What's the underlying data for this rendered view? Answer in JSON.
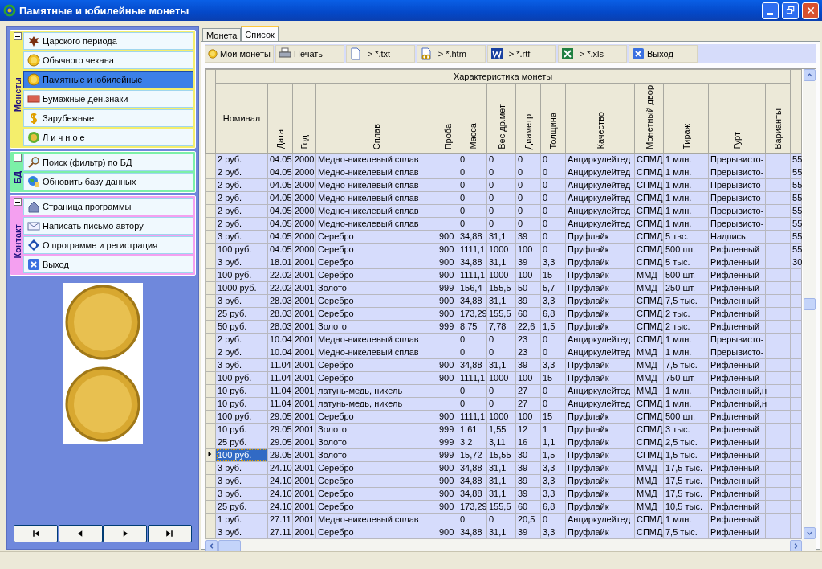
{
  "window": {
    "title": "Памятные и юбилейные монеты"
  },
  "sidebar": {
    "groups": [
      {
        "title": "Монеты",
        "color": "#f4ee6c",
        "expanded": true,
        "items": [
          {
            "label": "Царского периода",
            "selected": false
          },
          {
            "label": "Обычного чекана",
            "selected": false
          },
          {
            "label": "Памятные и юбилейные",
            "selected": true
          },
          {
            "label": "Бумажные ден.знаки",
            "selected": false
          },
          {
            "label": "Зарубежные",
            "selected": false
          },
          {
            "label": "Л и ч н о е",
            "selected": false
          }
        ]
      },
      {
        "title": "БД",
        "color": "#7cf0a8",
        "expanded": true,
        "items": [
          {
            "label": "Поиск (фильтр) по БД",
            "selected": false
          },
          {
            "label": "Обновить базу данных",
            "selected": false
          }
        ]
      },
      {
        "title": "Контакт",
        "color": "#f4a0f0",
        "expanded": true,
        "items": [
          {
            "label": "Страница программы",
            "selected": false
          },
          {
            "label": "Написать письмо автору",
            "selected": false
          },
          {
            "label": "О программе и регистрация",
            "selected": false
          },
          {
            "label": "Выход",
            "selected": false
          }
        ]
      }
    ]
  },
  "tabs": [
    {
      "label": "Монета",
      "selected": false
    },
    {
      "label": "Список",
      "selected": true
    }
  ],
  "toolbar": [
    "Мои монеты",
    "Печать",
    "-> *.txt",
    "-> *.htm",
    "-> *.rtf",
    "-> *.xls",
    "Выход"
  ],
  "table": {
    "group_header": "Характеристика монеты",
    "columns": [
      "Номинал",
      "Дата",
      "Год",
      "Сплав",
      "Проба",
      "Масса",
      "Вес др.мет.",
      "Диаметр",
      "Толщина",
      "Качество",
      "Монетный двор",
      "Тираж",
      "Гурт",
      "Варианты"
    ],
    "rows": [
      {
        "selected": false,
        "cells": [
          "2 руб.",
          "04.05",
          "2000",
          "Медно-никелевый сплав",
          null,
          "0",
          "0",
          "0",
          "0",
          "Анциркулейтед",
          "СПМД",
          "1 млн.",
          "Прерывисто-",
          null,
          "55"
        ]
      },
      {
        "selected": false,
        "cells": [
          "2 руб.",
          "04.05",
          "2000",
          "Медно-никелевый сплав",
          null,
          "0",
          "0",
          "0",
          "0",
          "Анциркулейтед",
          "СПМД",
          "1 млн.",
          "Прерывисто-",
          null,
          "55"
        ]
      },
      {
        "selected": false,
        "cells": [
          "2 руб.",
          "04.05",
          "2000",
          "Медно-никелевый сплав",
          null,
          "0",
          "0",
          "0",
          "0",
          "Анциркулейтед",
          "СПМД",
          "1 млн.",
          "Прерывисто-",
          null,
          "55"
        ]
      },
      {
        "selected": false,
        "cells": [
          "2 руб.",
          "04.05",
          "2000",
          "Медно-никелевый сплав",
          null,
          "0",
          "0",
          "0",
          "0",
          "Анциркулейтед",
          "СПМД",
          "1 млн.",
          "Прерывисто-",
          null,
          "55"
        ]
      },
      {
        "selected": false,
        "cells": [
          "2 руб.",
          "04.05",
          "2000",
          "Медно-никелевый сплав",
          null,
          "0",
          "0",
          "0",
          "0",
          "Анциркулейтед",
          "СПМД",
          "1 млн.",
          "Прерывисто-",
          null,
          "55"
        ]
      },
      {
        "selected": false,
        "cells": [
          "2 руб.",
          "04.05",
          "2000",
          "Медно-никелевый сплав",
          null,
          "0",
          "0",
          "0",
          "0",
          "Анциркулейтед",
          "СПМД",
          "1 млн.",
          "Прерывисто-",
          null,
          "55"
        ]
      },
      {
        "selected": false,
        "cells": [
          "3 руб.",
          "04.05",
          "2000",
          "Серебро",
          "900",
          "34,88",
          "31,1",
          "39",
          "0",
          "Пруфлайк",
          "СПМД",
          "5 твс.",
          "Надпись",
          null,
          "55"
        ]
      },
      {
        "selected": false,
        "cells": [
          "100 руб.",
          "04.05",
          "2000",
          "Серебро",
          "900",
          "1111,1",
          "1000",
          "100",
          "0",
          "Пруфлайк",
          "СПМД",
          "500 шт.",
          "Рифленный",
          null,
          "55"
        ]
      },
      {
        "selected": false,
        "cells": [
          "3 руб.",
          "18.01",
          "2001",
          "Серебро",
          "900",
          "34,88",
          "31,1",
          "39",
          "3,3",
          "Пруфлайк",
          "СПМД",
          "5 тыс.",
          "Рифленный",
          null,
          "30"
        ]
      },
      {
        "selected": false,
        "cells": [
          "100 руб.",
          "22.02",
          "2001",
          "Серебро",
          "900",
          "1111,1",
          "1000",
          "100",
          "15",
          "Пруфлайк",
          "ММД",
          "500 шт.",
          "Рифленный",
          null,
          null
        ]
      },
      {
        "selected": false,
        "cells": [
          "1000 руб.",
          "22.02",
          "2001",
          "Золото",
          "999",
          "156,4",
          "155,5",
          "50",
          "5,7",
          "Пруфлайк",
          "ММД",
          "250 шт.",
          "Рифленный",
          null,
          null
        ]
      },
      {
        "selected": false,
        "cells": [
          "3 руб.",
          "28.03",
          "2001",
          "Серебро",
          "900",
          "34,88",
          "31,1",
          "39",
          "3,3",
          "Пруфлайк",
          "СПМД",
          "7,5 тыс.",
          "Рифленный",
          null,
          null
        ]
      },
      {
        "selected": false,
        "cells": [
          "25 руб.",
          "28.03",
          "2001",
          "Серебро",
          "900",
          "173,29",
          "155,5",
          "60",
          "6,8",
          "Пруфлайк",
          "СПМД",
          "2 тыс.",
          "Рифленный",
          null,
          null
        ]
      },
      {
        "selected": false,
        "cells": [
          "50 руб.",
          "28.03",
          "2001",
          "Золото",
          "999",
          "8,75",
          "7,78",
          "22,6",
          "1,5",
          "Пруфлайк",
          "СПМД",
          "2 тыс.",
          "Рифленный",
          null,
          null
        ]
      },
      {
        "selected": false,
        "cells": [
          "2 руб.",
          "10.04",
          "2001",
          "Медно-никелевый сплав",
          null,
          "0",
          "0",
          "23",
          "0",
          "Анциркулейтед",
          "СПМД",
          "1 млн.",
          "Прерывисто-",
          null,
          null
        ]
      },
      {
        "selected": false,
        "cells": [
          "2 руб.",
          "10.04",
          "2001",
          "Медно-никелевый сплав",
          null,
          "0",
          "0",
          "23",
          "0",
          "Анциркулейтед",
          "ММД",
          "1 млн.",
          "Прерывисто-",
          null,
          null
        ]
      },
      {
        "selected": false,
        "cells": [
          "3 руб.",
          "11.04",
          "2001",
          "Серебро",
          "900",
          "34,88",
          "31,1",
          "39",
          "3,3",
          "Пруфлайк",
          "ММД",
          "7,5 тыс.",
          "Рифленный",
          null,
          null
        ]
      },
      {
        "selected": false,
        "cells": [
          "100 руб.",
          "11.04",
          "2001",
          "Серебро",
          "900",
          "1111,1",
          "1000",
          "100",
          "15",
          "Пруфлайк",
          "ММД",
          "750 шт.",
          "Рифленный",
          null,
          null
        ]
      },
      {
        "selected": false,
        "cells": [
          "10 руб.",
          "11.04",
          "2001",
          "латунь-медь, никель",
          null,
          "0",
          "0",
          "27",
          "0",
          "Анциркулейтед",
          "ММД",
          "1 млн.",
          "Рифленный,н",
          null,
          null
        ]
      },
      {
        "selected": false,
        "cells": [
          "10 руб.",
          "11.04",
          "2001",
          "латунь-медь, никель",
          null,
          "0",
          "0",
          "27",
          "0",
          "Анциркулейтед",
          "СПМД",
          "1 млн.",
          "Рифленный,н",
          null,
          null
        ]
      },
      {
        "selected": false,
        "cells": [
          "100 руб.",
          "29.05",
          "2001",
          "Серебро",
          "900",
          "1111,1",
          "1000",
          "100",
          "15",
          "Пруфлайк",
          "СПМД",
          "500 шт.",
          "Рифленный",
          null,
          null
        ]
      },
      {
        "selected": false,
        "cells": [
          "10 руб.",
          "29.05",
          "2001",
          "Золото",
          "999",
          "1,61",
          "1,55",
          "12",
          "1",
          "Пруфлайк",
          "СПМД",
          "3 тыс.",
          "Рифленный",
          null,
          null
        ]
      },
      {
        "selected": false,
        "cells": [
          "25 руб.",
          "29.05",
          "2001",
          "Золото",
          "999",
          "3,2",
          "3,11",
          "16",
          "1,1",
          "Пруфлайк",
          "СПМД",
          "2,5 тыс.",
          "Рифленный",
          null,
          null
        ]
      },
      {
        "selected": true,
        "cells": [
          "100 руб.",
          "29.05",
          "2001",
          "Золото",
          "999",
          "15,72",
          "15,55",
          "30",
          "1,5",
          "Пруфлайк",
          "СПМД",
          "1,5 тыс.",
          "Рифленный",
          null,
          null
        ]
      },
      {
        "selected": false,
        "cells": [
          "3 руб.",
          "24.10",
          "2001",
          "Серебро",
          "900",
          "34,88",
          "31,1",
          "39",
          "3,3",
          "Пруфлайк",
          "ММД",
          "17,5 тыс.",
          "Рифленный",
          null,
          null
        ]
      },
      {
        "selected": false,
        "cells": [
          "3 руб.",
          "24.10",
          "2001",
          "Серебро",
          "900",
          "34,88",
          "31,1",
          "39",
          "3,3",
          "Пруфлайк",
          "ММД",
          "17,5 тыс.",
          "Рифленный",
          null,
          null
        ]
      },
      {
        "selected": false,
        "cells": [
          "3 руб.",
          "24.10",
          "2001",
          "Серебро",
          "900",
          "34,88",
          "31,1",
          "39",
          "3,3",
          "Пруфлайк",
          "ММД",
          "17,5 тыс.",
          "Рифленный",
          null,
          null
        ]
      },
      {
        "selected": false,
        "cells": [
          "25 руб.",
          "24.10",
          "2001",
          "Серебро",
          "900",
          "173,29",
          "155,5",
          "60",
          "6,8",
          "Пруфлайк",
          "ММД",
          "10,5 тыс.",
          "Рифленный",
          null,
          null
        ]
      },
      {
        "selected": false,
        "cells": [
          "1 руб.",
          "27.11",
          "2001",
          "Медно-никелевый сплав",
          null,
          "0",
          "0",
          "20,5",
          "0",
          "Анциркулейтед",
          "СПМД",
          "1 млн.",
          "Рифленный",
          null,
          null
        ]
      },
      {
        "selected": false,
        "cells": [
          "3 руб.",
          "27.11",
          "2001",
          "Серебро",
          "900",
          "34,88",
          "31,1",
          "39",
          "3,3",
          "Пруфлайк",
          "СПМД",
          "7,5 тыс.",
          "Рифленный",
          null,
          null
        ]
      }
    ]
  }
}
